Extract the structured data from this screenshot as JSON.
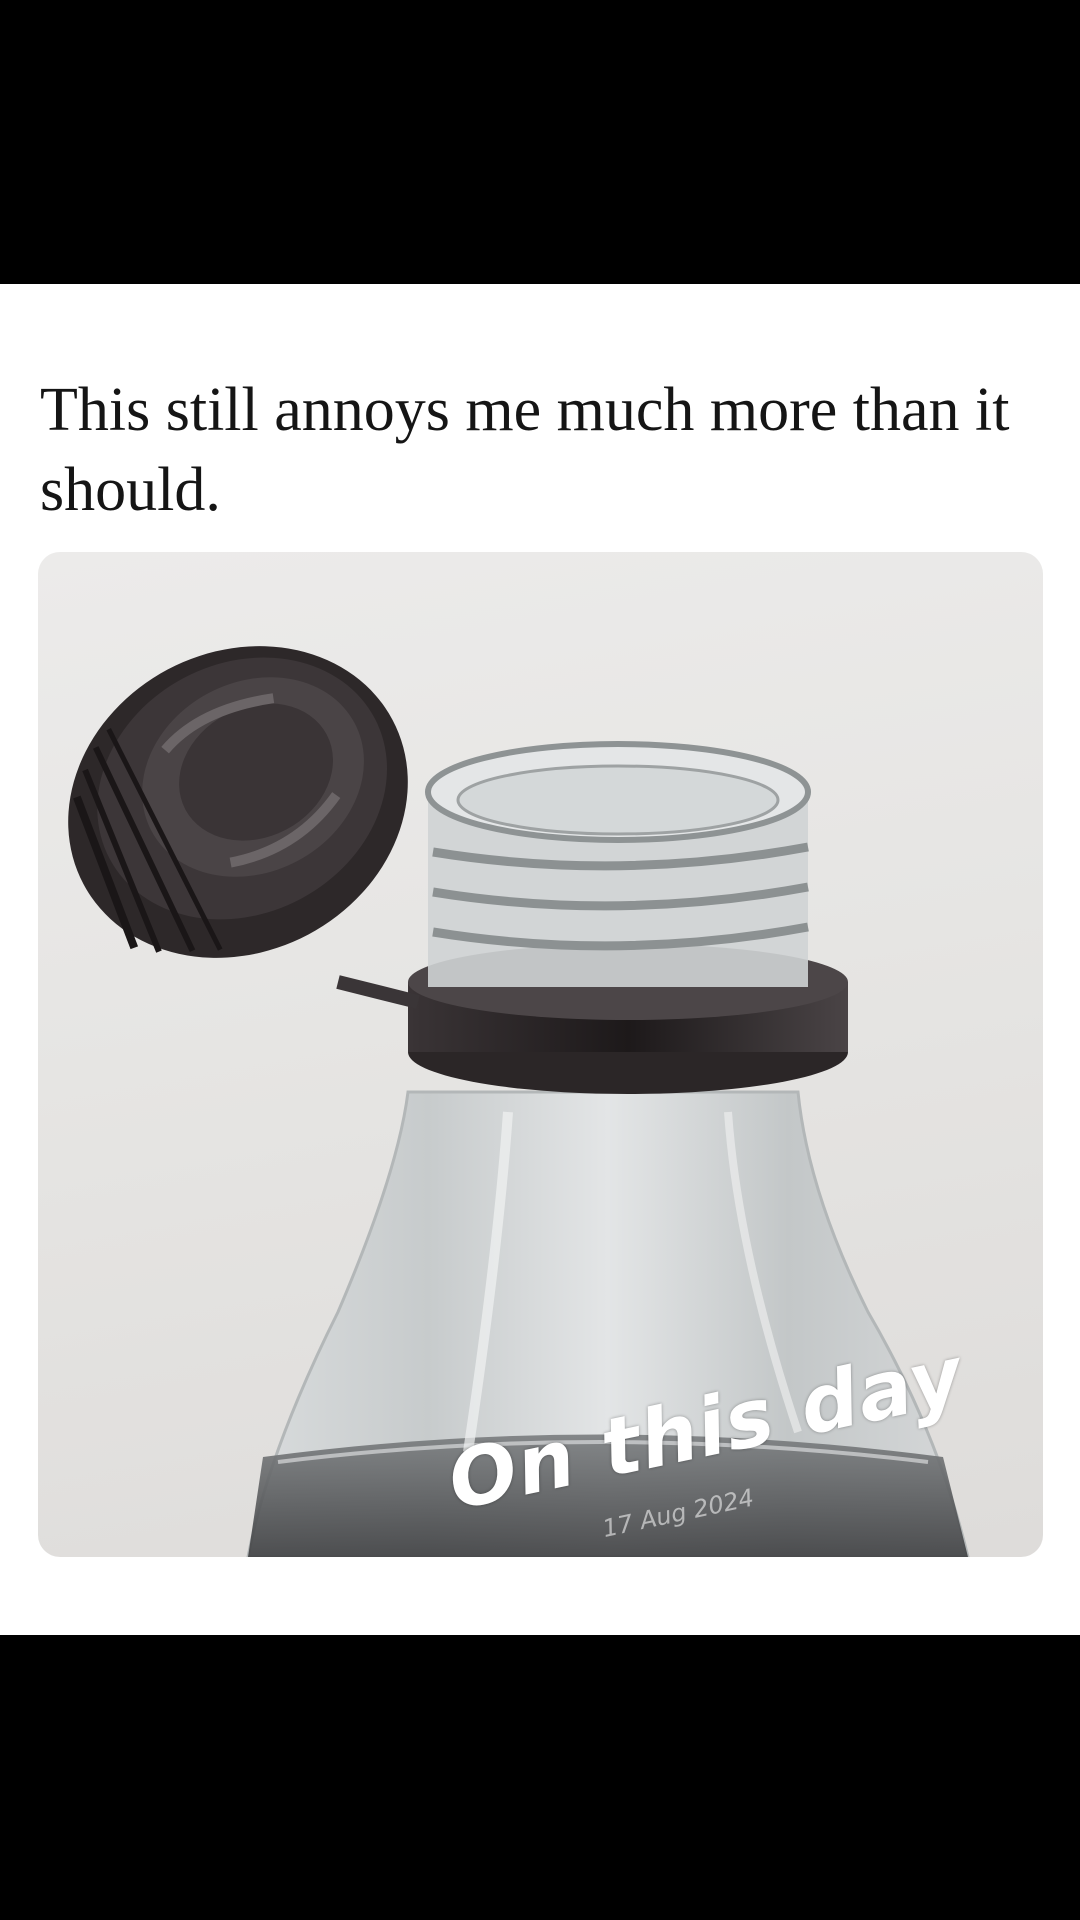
{
  "post": {
    "caption": "This still annoys me much more than it should."
  },
  "image": {
    "subject": "plastic bottle with tethered cap",
    "colors": {
      "background": "#e8e7e5",
      "cap": "#2a2526",
      "bottle": "#c9cccd"
    }
  },
  "sticker": {
    "title": "On this day",
    "date": "17 Aug 2024"
  },
  "colors": {
    "letterbox": "#000000",
    "card": "#ffffff",
    "text": "#151515"
  }
}
